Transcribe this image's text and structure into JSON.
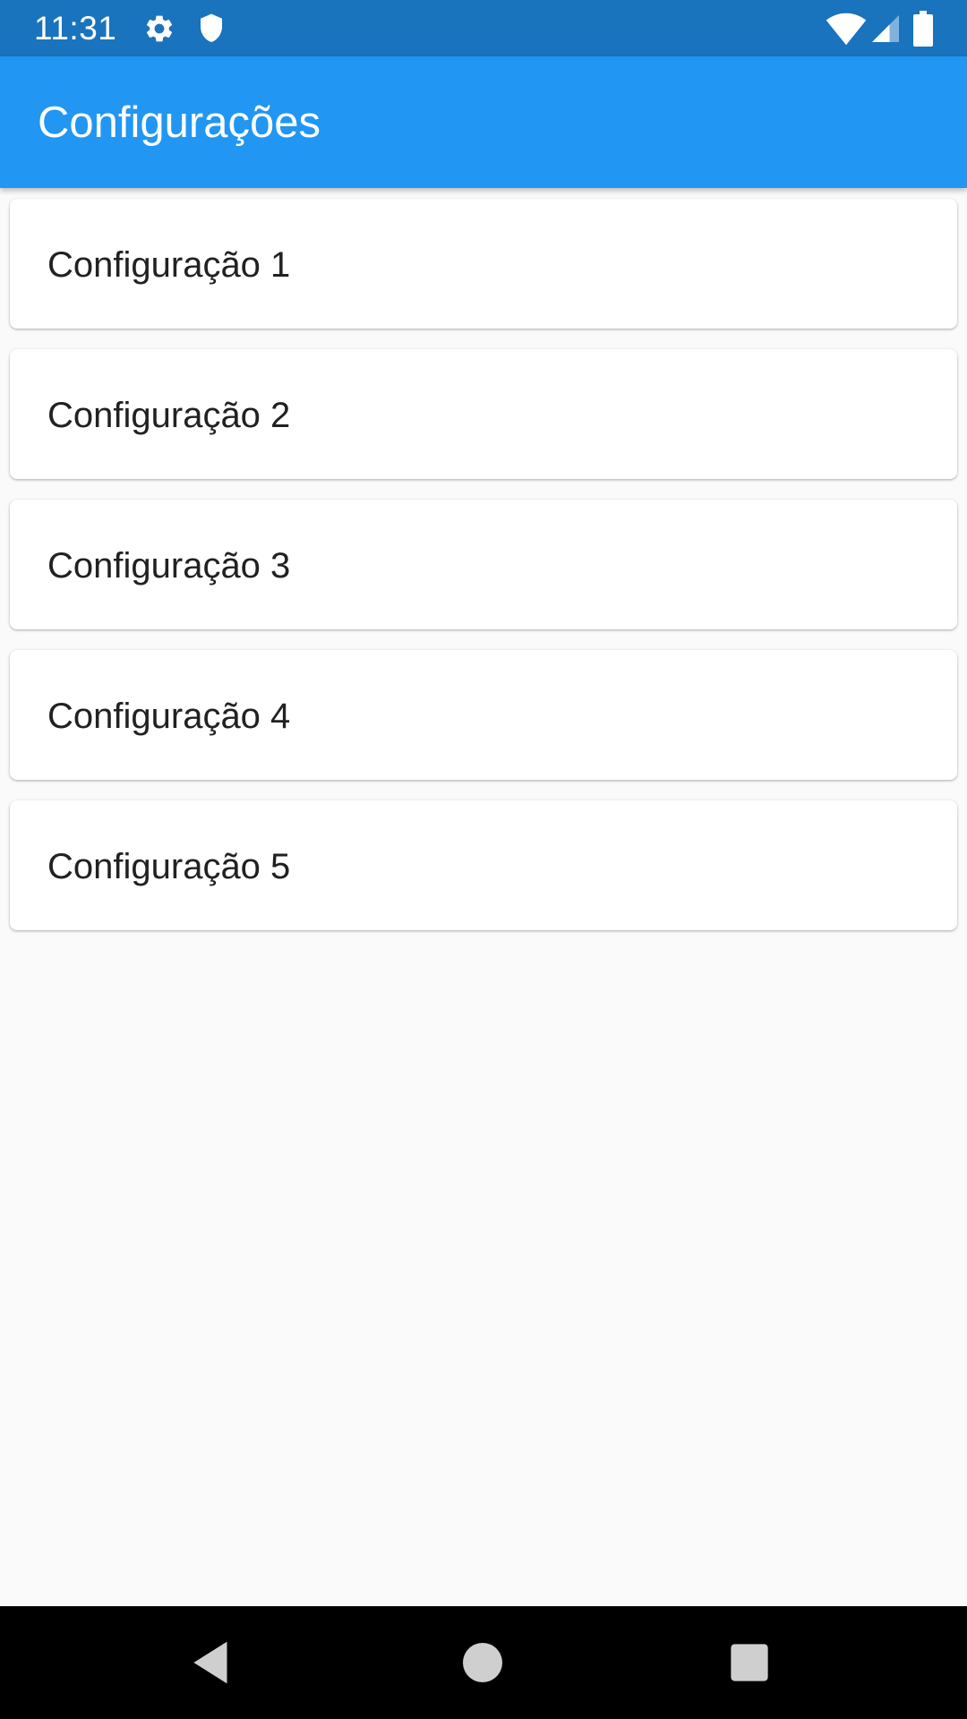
{
  "status_bar": {
    "time": "11:31",
    "icons": [
      "gear-icon",
      "shield-icon",
      "wifi-icon",
      "signal-icon",
      "battery-icon"
    ],
    "background_color": "#1a73bd"
  },
  "app_bar": {
    "title": "Configurações",
    "background_color": "#2196f3"
  },
  "settings": {
    "items": [
      {
        "label": "Configuração 1"
      },
      {
        "label": "Configuração 2"
      },
      {
        "label": "Configuração 3"
      },
      {
        "label": "Configuração 4"
      },
      {
        "label": "Configuração 5"
      }
    ]
  },
  "nav_bar": {
    "buttons": [
      "back-icon",
      "home-icon",
      "recents-icon"
    ]
  }
}
